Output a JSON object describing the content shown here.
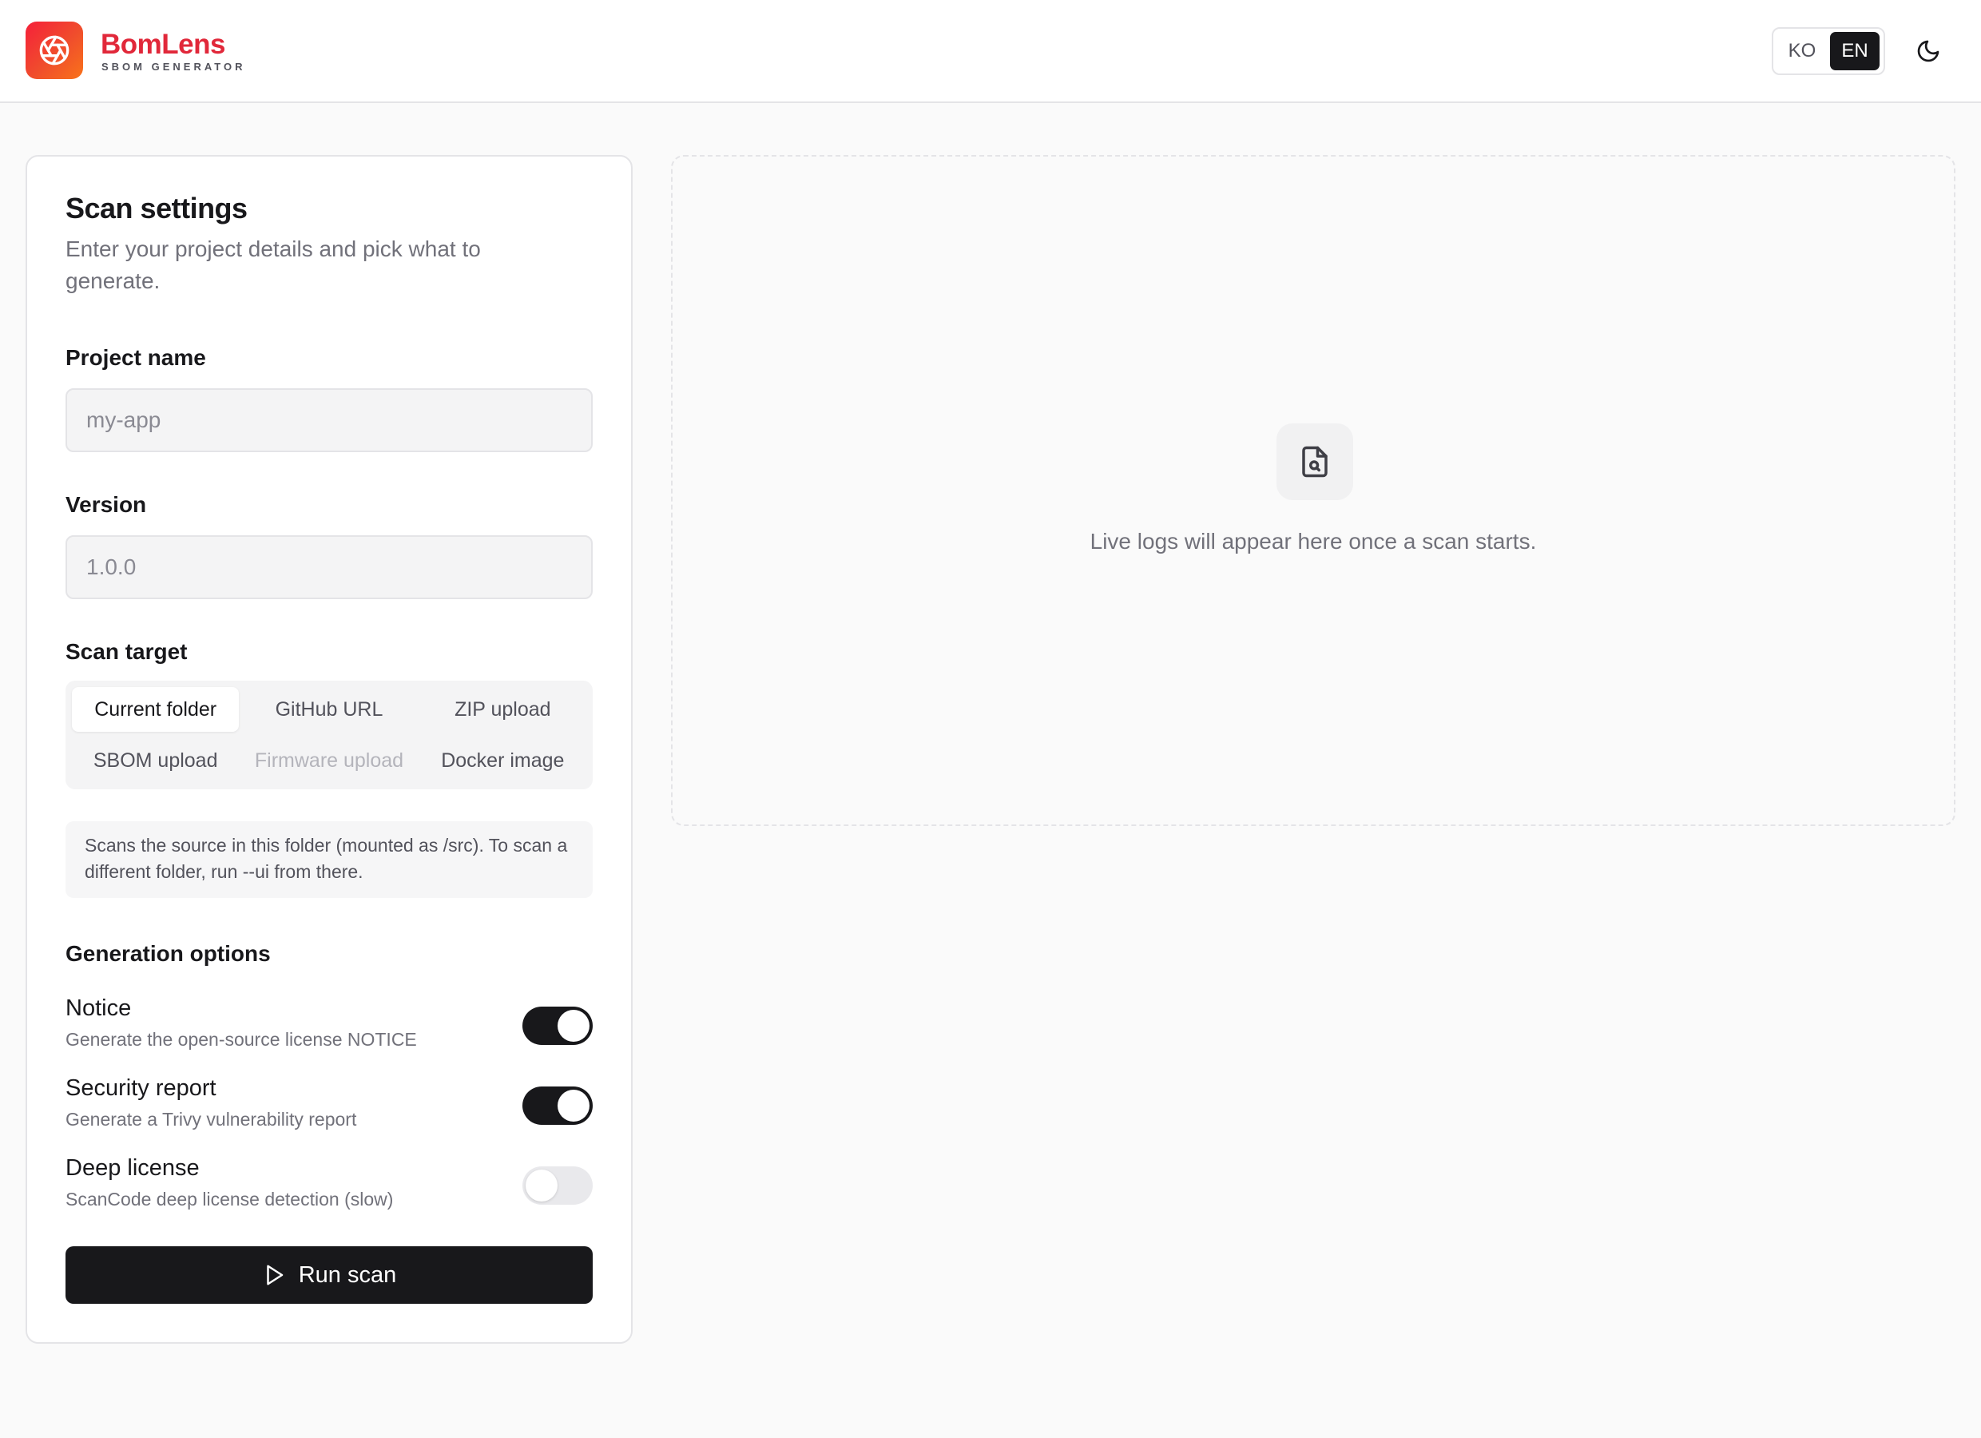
{
  "header": {
    "brand_name": "BomLens",
    "brand_sub": "SBOM GENERATOR",
    "logo_icon": "aperture-icon",
    "languages": [
      {
        "label": "KO",
        "active": false
      },
      {
        "label": "EN",
        "active": true
      }
    ],
    "theme_icon": "moon-icon"
  },
  "settings": {
    "title": "Scan settings",
    "description": "Enter your project details and pick what to generate.",
    "project_name": {
      "label": "Project name",
      "value": "",
      "placeholder": "my-app"
    },
    "version": {
      "label": "Version",
      "value": "",
      "placeholder": "1.0.0"
    },
    "scan_target": {
      "label": "Scan target",
      "options": [
        {
          "label": "Current folder",
          "state": "selected"
        },
        {
          "label": "GitHub URL",
          "state": "normal"
        },
        {
          "label": "ZIP upload",
          "state": "normal"
        },
        {
          "label": "SBOM upload",
          "state": "normal"
        },
        {
          "label": "Firmware upload",
          "state": "disabled"
        },
        {
          "label": "Docker image",
          "state": "normal"
        }
      ],
      "help_text": "Scans the source in this folder (mounted as /src). To scan a different folder, run --ui from there."
    },
    "generation_options": {
      "label": "Generation options",
      "options": [
        {
          "title": "Notice",
          "description": "Generate the open-source license NOTICE",
          "enabled": true
        },
        {
          "title": "Security report",
          "description": "Generate a Trivy vulnerability report",
          "enabled": true
        },
        {
          "title": "Deep license",
          "description": "ScanCode deep license detection (slow)",
          "enabled": false
        }
      ]
    },
    "run_button": {
      "label": "Run scan",
      "icon": "play-icon"
    }
  },
  "logs": {
    "icon": "file-search-icon",
    "empty_text": "Live logs will appear here once a scan starts."
  },
  "colors": {
    "brand": "#e1283a",
    "dark": "#18181b",
    "muted": "#71717a"
  }
}
